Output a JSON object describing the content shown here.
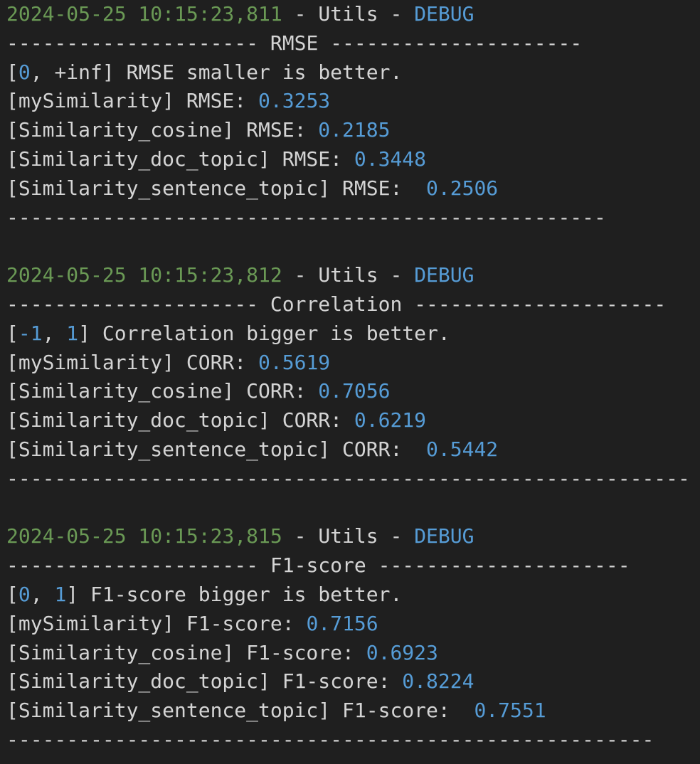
{
  "blocks": [
    {
      "header": {
        "timestamp": "2024-05-25 10:15:23,811",
        "sep1": " - ",
        "logger": "Utils",
        "sep2": " - ",
        "level": "DEBUG"
      },
      "title_line": {
        "left": "--------------------- ",
        "title": "RMSE",
        "right": " ---------------------"
      },
      "range_line": {
        "open": "[",
        "low": "0",
        "comma": ", ",
        "high": "+inf",
        "close": "] ",
        "text": "RMSE smaller is better."
      },
      "rows": [
        {
          "label": "[mySimilarity] RMSE: ",
          "value": "0.3253"
        },
        {
          "label": "[Similarity_cosine] RMSE: ",
          "value": "0.2185"
        },
        {
          "label": "[Similarity_doc_topic] RMSE: ",
          "value": "0.3448"
        },
        {
          "label": "[Similarity_sentence_topic] RMSE:  ",
          "value": "0.2506"
        }
      ],
      "footer": "--------------------------------------------------"
    },
    {
      "header": {
        "timestamp": "2024-05-25 10:15:23,812",
        "sep1": " - ",
        "logger": "Utils",
        "sep2": " - ",
        "level": "DEBUG"
      },
      "title_line": {
        "left": "--------------------- ",
        "title": "Correlation",
        "right": " ---------------------"
      },
      "range_line": {
        "open": "[",
        "low": "-1",
        "comma": ", ",
        "high": "1",
        "close": "] ",
        "text": "Correlation bigger is better."
      },
      "rows": [
        {
          "label": "[mySimilarity] CORR: ",
          "value": "0.5619"
        },
        {
          "label": "[Similarity_cosine] CORR: ",
          "value": "0.7056"
        },
        {
          "label": "[Similarity_doc_topic] CORR: ",
          "value": "0.6219"
        },
        {
          "label": "[Similarity_sentence_topic] CORR:  ",
          "value": "0.5442"
        }
      ],
      "footer": "---------------------------------------------------------"
    },
    {
      "header": {
        "timestamp": "2024-05-25 10:15:23,815",
        "sep1": " - ",
        "logger": "Utils",
        "sep2": " - ",
        "level": "DEBUG"
      },
      "title_line": {
        "left": "--------------------- ",
        "title": "F1-score",
        "right": " ---------------------"
      },
      "range_line": {
        "open": "[",
        "low": "0",
        "comma": ", ",
        "high": "1",
        "close": "] ",
        "text": "F1-score bigger is better."
      },
      "rows": [
        {
          "label": "[mySimilarity] F1-score: ",
          "value": "0.7156"
        },
        {
          "label": "[Similarity_cosine] F1-score: ",
          "value": "0.6923"
        },
        {
          "label": "[Similarity_doc_topic] F1-score: ",
          "value": "0.8224"
        },
        {
          "label": "[Similarity_sentence_topic] F1-score:  ",
          "value": "0.7551"
        }
      ],
      "footer": "------------------------------------------------------"
    }
  ],
  "colors": {
    "background": "#1f1f1f",
    "text": "#d4d4d4",
    "timestamp": "#6a9955",
    "keyword_number": "#569cd6"
  }
}
